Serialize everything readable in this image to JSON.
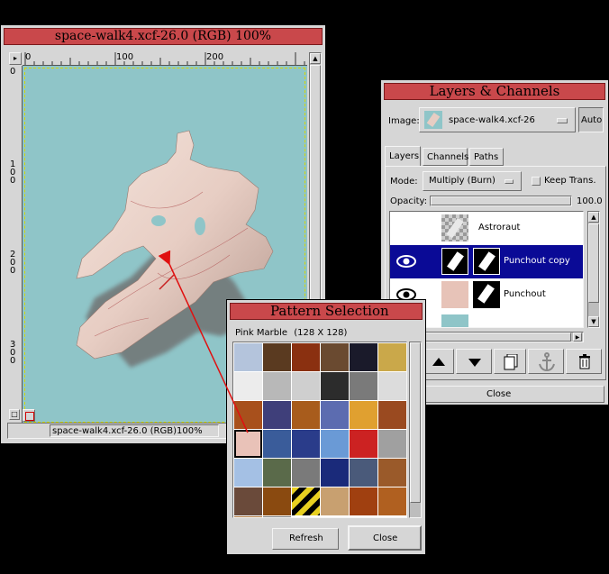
{
  "image_window": {
    "title": "space-walk4.xcf-26.0 (RGB) 100%",
    "status": "space-walk4.xcf-26.0 (RGB)100%",
    "ruler_top": [
      "0",
      "100",
      "200"
    ],
    "ruler_left": [
      "0",
      "100",
      "200",
      "300"
    ],
    "canvas_color": "#8fc5c8"
  },
  "layers_dialog": {
    "title": "Layers & Channels",
    "image_label": "Image:",
    "image_value": "space-walk4.xcf-26",
    "auto_label": "Auto",
    "tabs": [
      "Layers",
      "Channels",
      "Paths"
    ],
    "mode_label": "Mode:",
    "mode_value": "Multiply (Burn)",
    "keep_trans_label": "Keep Trans.",
    "opacity_label": "Opacity:",
    "opacity_value": "100.0",
    "opacity_fraction": 1.0,
    "layers": [
      {
        "name": "Astroraut",
        "selected": false,
        "visible": false
      },
      {
        "name": "Punchout copy",
        "selected": true,
        "visible": true
      },
      {
        "name": "Punchout",
        "selected": false,
        "visible": true
      }
    ],
    "close_label": "Close",
    "selection_color": "#0a0a96"
  },
  "pattern_dialog": {
    "title": "Pattern Selection",
    "pattern_name": "Pink Marble",
    "pattern_size": "(128 X 128)",
    "refresh_label": "Refresh",
    "close_label": "Close",
    "tile_colors": [
      [
        "#b4c4dc",
        "#5a3a20",
        "#8a3010",
        "#6a4a30",
        "#1a1a2a",
        "#caa84a"
      ],
      [
        "#ececec",
        "#b8b8b8",
        "#cfcfcf",
        "#2c2c2c",
        "#7a7a7a",
        "#dcdcdc"
      ],
      [
        "#a8501c",
        "#3f3f7a",
        "#a85c1c",
        "#5c6cb0",
        "#e0a030",
        "#9a4a20"
      ],
      [
        "#e9c2b8",
        "#3a5c9a",
        "#2a3c8a",
        "#6a9ad6",
        "#cc2222",
        "#a0a0a0"
      ],
      [
        "#a4c0e4",
        "#5a6a4a",
        "#7a7a7a",
        "#1a2a7a",
        "#4a5a7a",
        "#9a5a2a"
      ],
      [
        "#6a4a3a",
        "#8a4a10",
        "#e8d020",
        "#c8a070",
        "#a04010",
        "#b06020"
      ],
      [
        "#b07a40",
        "#7a7a7a",
        "#ffffff",
        "#ffffff",
        "#ffffff",
        "#ffffff"
      ]
    ]
  }
}
